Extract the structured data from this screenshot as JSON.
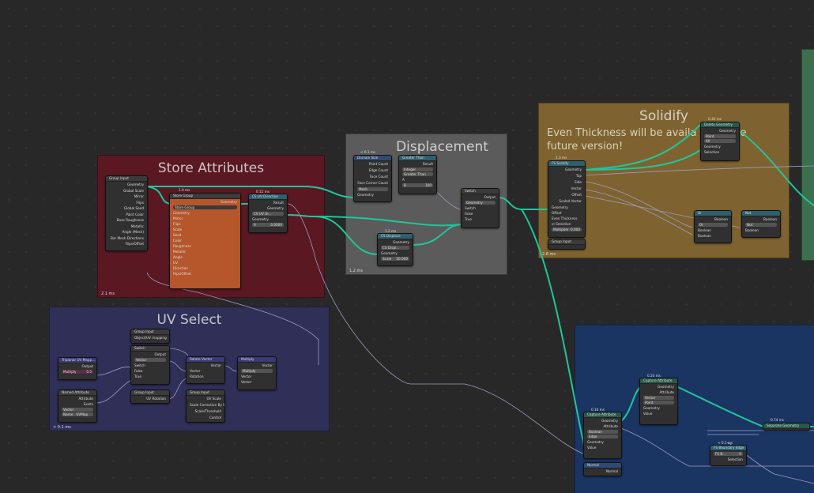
{
  "frames": {
    "store_attributes": {
      "title": "Store Attributes",
      "time": "2.1 ms"
    },
    "displacement": {
      "title": "Displacement",
      "time": "1.2 ms"
    },
    "solidify": {
      "title": "Solidify",
      "note_line1": "Even Thickness will be availa",
      "note_line1b": "e",
      "note_line2": "future version!",
      "time": "2.8 ms"
    },
    "uv_select": {
      "title": "UV Select",
      "time": "< 0.1 ms"
    }
  },
  "nodes": {
    "group_input_store": {
      "title": "Group Input",
      "rows": [
        "Geometry",
        "Global Scale",
        "Mirror",
        "Flips",
        "Global Seed",
        "Paint Color",
        "Base Roughness",
        "Metallic",
        "Angle (Mesh)",
        "Bar Mesh Directions",
        "Rips/Offset"
      ]
    },
    "store_group": {
      "time": "1.9 ms",
      "title": "Store Group",
      "out": "Geometry",
      "field": "Store Group",
      "rows": [
        "Geometry",
        "Mirror",
        "Flips",
        "Scale",
        "Seed",
        "Color",
        "Roughness",
        "Metallic",
        "Angle",
        "UV",
        "Direction",
        "Rips/Offset"
      ]
    },
    "cs_uv": {
      "time": "0.12 ms",
      "title": "CS UV Direction",
      "out1": "Result",
      "out2": "Geometry",
      "field": "CS UV Di...",
      "in": "Geometry",
      "val1": "0",
      "val2": "0.0000"
    },
    "domain_size": {
      "time": "< 0.1 ms",
      "title": "Domain Size",
      "rows": [
        "Point Count",
        "Edge Count",
        "Face Count",
        "Face Corner Count"
      ],
      "field": "Mesh",
      "in": "Geometry"
    },
    "greater_than": {
      "title": "Greater Than",
      "out": "Result",
      "f1": "Integer",
      "f2": "Greater Than",
      "a": "A",
      "b": "B",
      "bval": "100"
    },
    "switch_disp": {
      "title": "Switch",
      "out": "Output",
      "field": "Geometry",
      "rows": [
        "Switch",
        "False",
        "True"
      ]
    },
    "cs_displace": {
      "time": "1.2 ms",
      "title": "CS Displace",
      "out": "Geometry",
      "field": "CS Displ...",
      "in": "Geometry",
      "scale_label": "Scale",
      "scale_val": "50.000"
    },
    "fs_solidify": {
      "time": "2.3 ms",
      "title": "FS Solidify",
      "rows": [
        "Geometry",
        "Top",
        "Side",
        "Vector",
        "Offset",
        "Scaled Vector"
      ],
      "in_geo": "Geometry",
      "offset": "Offset",
      "even": "Even Thickness",
      "sel": "Selection",
      "mult_label": "Multiplier",
      "mult_val": "0.000"
    },
    "group_input_solid": {
      "title": "Group Input"
    },
    "delete_geo": {
      "time": "0.34 ms",
      "title": "Delete Geometry",
      "out": "Geometry",
      "f1": "Point",
      "f2": "All",
      "rows": [
        "Geometry",
        "Selection"
      ]
    },
    "or_node": {
      "title": "Or",
      "out": "Boolean",
      "field": "Or",
      "rows": [
        "Boolean",
        "Boolean"
      ]
    },
    "not_node": {
      "title": "Not",
      "out": "Boolean",
      "field": "Not",
      "in": "Boolean"
    },
    "triplanar": {
      "title": "Triplanar UV Mapp...",
      "out": "Output",
      "field": "Multiply",
      "val": "0.5"
    },
    "named_attr": {
      "title": "Named Attribute",
      "rows": [
        "Attribute",
        "Exists"
      ],
      "field": "Vector",
      "name_label": "Name",
      "name_val": "UVMap"
    },
    "group_input_uv1": {
      "title": "Group Input",
      "out": "Object/UV mapping"
    },
    "switch_uv": {
      "title": "Switch",
      "out": "Output",
      "field": "Vector",
      "rows": [
        "Switch",
        "False",
        "True"
      ]
    },
    "group_input_uv2": {
      "title": "Group Input",
      "out": "UV Rotation"
    },
    "rotate_vector": {
      "title": "Rotate Vector",
      "out": "Vector",
      "rows": [
        "Vector",
        "Rotation"
      ]
    },
    "group_input_uv3": {
      "title": "Group Input",
      "rows": [
        "UV Scale",
        "Scale Correction By S...",
        "Scale/Threshold",
        "Control"
      ]
    },
    "multiply_vec": {
      "title": "Multiply",
      "out": "Vector",
      "field": "Multiply",
      "rows": [
        "Vector",
        "Vector"
      ]
    },
    "capture_attr1": {
      "time": "0.16 ms",
      "title": "Capture Attribute",
      "rows": [
        "Geometry",
        "Attribute"
      ],
      "f1": "Boolean",
      "f2": "Edge",
      "ins": [
        "Geometry",
        "Value"
      ]
    },
    "capture_attr2": {
      "time": "0.20 ms",
      "title": "Capture Attribute",
      "rows": [
        "Geometry",
        "Attribute"
      ],
      "f1": "Vector",
      "f2": "Point",
      "ins": [
        "Geometry",
        "Value"
      ]
    },
    "normal": {
      "title": "Normal",
      "out": "Normal"
    },
    "fs_boundary": {
      "time": "< 0.1 ms",
      "title": "FS Boundary Edge",
      "field": "FS B...",
      "val": "0",
      "out": "Selection"
    },
    "separate_geo": {
      "time": "0.74 ms",
      "title": "Separate Geometry"
    }
  },
  "colors": {
    "wire_geo": "#1fc69b",
    "wire_field": "#a3a3c2",
    "store": "#5a1823",
    "displacement": "#5b5b5b",
    "solidify": "#7e6330",
    "uvselect": "#2f2f58",
    "blue": "#1b3563",
    "green": "#3c6f4b"
  }
}
